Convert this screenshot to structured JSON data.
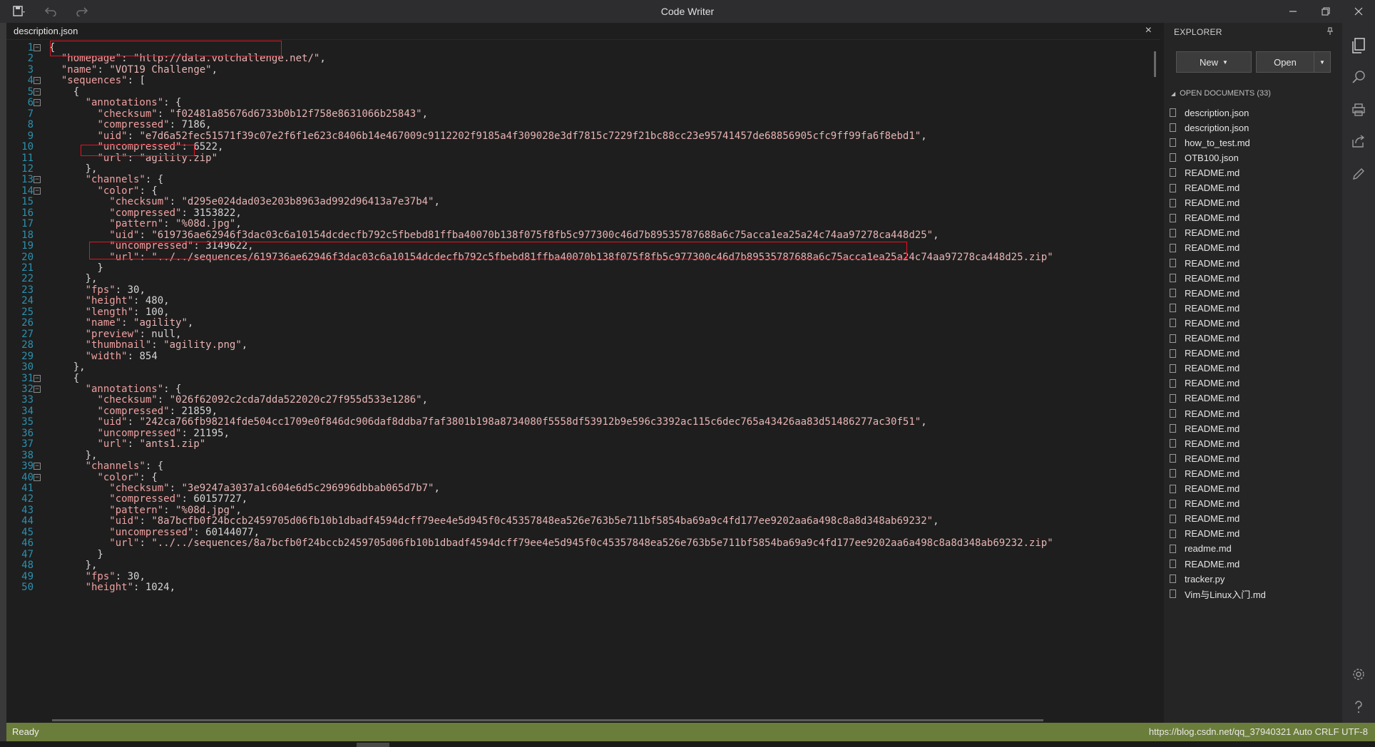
{
  "app": {
    "title": "Code Writer"
  },
  "titlebar": {
    "save_icon": "save-icon",
    "undo_icon": "undo-icon",
    "redo_icon": "redo-icon",
    "minimize_icon": "minimize-icon",
    "restore_icon": "restore-icon",
    "close_icon": "close-icon"
  },
  "editor": {
    "tab_label": "description.json",
    "close_glyph": "×",
    "lines": [
      "{",
      "  \"homepage\": \"http://data.votchallenge.net/\",",
      "  \"name\": \"VOT19 Challenge\",",
      "  \"sequences\": [",
      "    {",
      "      \"annotations\": {",
      "        \"checksum\": \"f02481a85676d6733b0b12f758e8631066b25843\",",
      "        \"compressed\": 7186,",
      "        \"uid\": \"e7d6a52fec51571f39c07e2f6f1e623c8406b14e467009c9112202f9185a4f309028e3df7815c7229f21bc88cc23e95741457de68856905cfc9ff99fa6f8ebd1\",",
      "        \"uncompressed\": 6522,",
      "        \"url\": \"agility.zip\"",
      "      },",
      "      \"channels\": {",
      "        \"color\": {",
      "          \"checksum\": \"d295e024dad03e203b8963ad992d96413a7e37b4\",",
      "          \"compressed\": 3153822,",
      "          \"pattern\": \"%08d.jpg\",",
      "          \"uid\": \"619736ae62946f3dac03c6a10154dcdecfb792c5fbebd81ffba40070b138f075f8fb5c977300c46d7b89535787688a6c75acca1ea25a24c74aa97278ca448d25\",",
      "          \"uncompressed\": 3149622,",
      "          \"url\": \"../../sequences/619736ae62946f3dac03c6a10154dcdecfb792c5fbebd81ffba40070b138f075f8fb5c977300c46d7b89535787688a6c75acca1ea25a24c74aa97278ca448d25.zip\"",
      "        }",
      "      },",
      "      \"fps\": 30,",
      "      \"height\": 480,",
      "      \"length\": 100,",
      "      \"name\": \"agility\",",
      "      \"preview\": null,",
      "      \"thumbnail\": \"agility.png\",",
      "      \"width\": 854",
      "    },",
      "    {",
      "      \"annotations\": {",
      "        \"checksum\": \"026f62092c2cda7dda522020c27f955d533e1286\",",
      "        \"compressed\": 21859,",
      "        \"uid\": \"242ca766fb98214fde504cc1709e0f846dc906daf8ddba7faf3801b198a8734080f5558df53912b9e596c3392ac115c6dec765a43426aa83d51486277ac30f51\",",
      "        \"uncompressed\": 21195,",
      "        \"url\": \"ants1.zip\"",
      "      },",
      "      \"channels\": {",
      "        \"color\": {",
      "          \"checksum\": \"3e9247a3037a1c604e6d5c296996dbbab065d7b7\",",
      "          \"compressed\": 60157727,",
      "          \"pattern\": \"%08d.jpg\",",
      "          \"uid\": \"8a7bcfb0f24bccb2459705d06fb10b1dbadf4594dcff79ee4e5d945f0c45357848ea526e763b5e711bf5854ba69a9c4fd177ee9202aa6a498c8a8d348ab69232\",",
      "          \"uncompressed\": 60144077,",
      "          \"url\": \"../../sequences/8a7bcfb0f24bccb2459705d06fb10b1dbadf4594dcff79ee4e5d945f0c45357848ea526e763b5e711bf5854ba69a9c4fd177ee9202aa6a498c8a8d348ab69232.zip\"",
      "        }",
      "      },",
      "      \"fps\": 30,",
      "      \"height\": 1024,"
    ],
    "fold_lines": [
      1,
      4,
      5,
      6,
      13,
      14,
      31,
      32,
      39,
      40
    ],
    "highlight_color": "#e81123"
  },
  "explorer": {
    "title": "EXPLORER",
    "pin_icon": "pin-icon",
    "new_button": "New",
    "open_button": "Open",
    "section_label": "OPEN DOCUMENTS (33)",
    "files": [
      "description.json",
      "description.json",
      "how_to_test.md",
      "OTB100.json",
      "README.md",
      "README.md",
      "README.md",
      "README.md",
      "README.md",
      "README.md",
      "README.md",
      "README.md",
      "README.md",
      "README.md",
      "README.md",
      "README.md",
      "README.md",
      "README.md",
      "README.md",
      "README.md",
      "README.md",
      "README.md",
      "README.md",
      "README.md",
      "README.md",
      "README.md",
      "README.md",
      "README.md",
      "README.md",
      "readme.md",
      "README.md",
      "tracker.py",
      "Vim与Linux入门.md"
    ]
  },
  "activity": {
    "icons": [
      "documents-icon",
      "search-icon",
      "print-icon",
      "share-icon",
      "pen-icon"
    ],
    "bottom_icons": [
      "settings-icon",
      "help-icon"
    ]
  },
  "status": {
    "text": "Ready",
    "right_text": "https://blog.csdn.net/qq_37940321  Auto  CRLF  UTF-8"
  },
  "colors": {
    "accent_status": "#6b7d3a",
    "line_number": "#2b91af",
    "key": "#f0a0a0",
    "keyword": "#569cd6"
  }
}
